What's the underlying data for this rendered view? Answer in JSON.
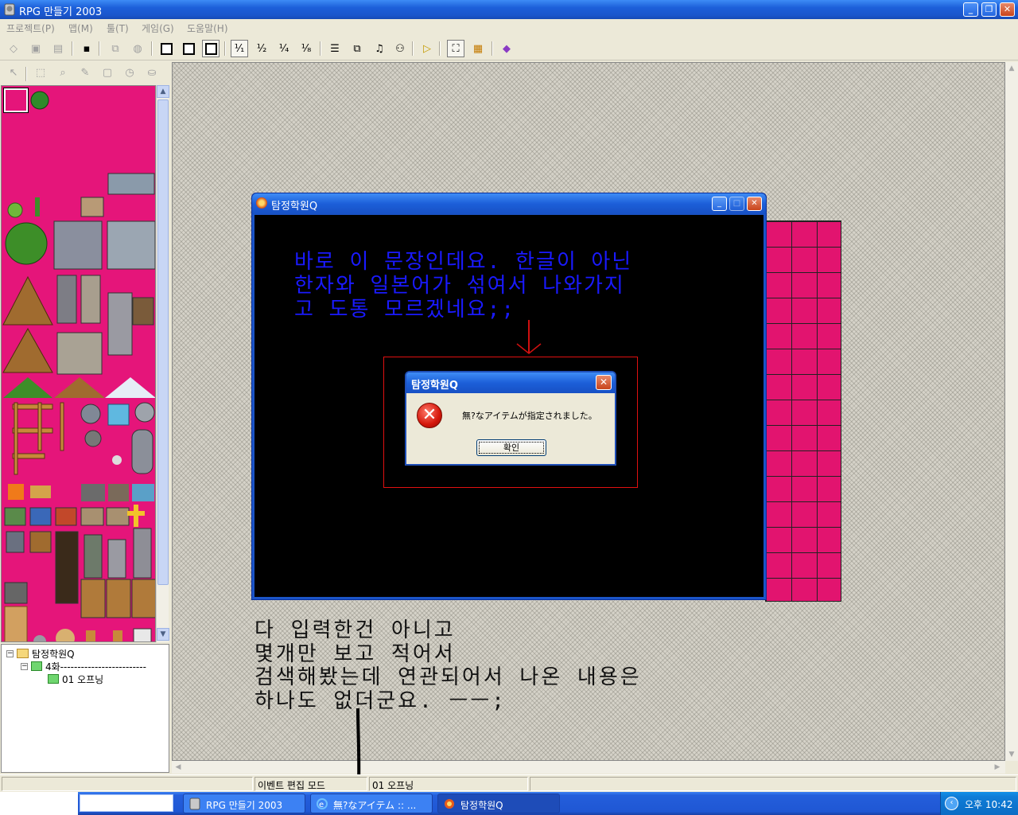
{
  "window": {
    "title": "RPG 만들기 2003"
  },
  "menu": [
    "프로젝트(P)",
    "맵(M)",
    "툴(T)",
    "게임(G)",
    "도움말(H)"
  ],
  "maptree": {
    "root": "탐정학원Q",
    "child": "4화-------------------------",
    "grandchild": "01 오프닝"
  },
  "game_window": {
    "title": "탐정학원Q",
    "text": "바로 이 문장인데요. 한글이 아닌\n한자와 일본어가 섞여서 나와가지\n고 도통 모르겠네요;;"
  },
  "error_dialog": {
    "title": "탐정학원Q",
    "message": "無?なアイテムが指定されました。",
    "ok_label": "확인"
  },
  "note_text": "다 입력한건 아니고\n몇개만 보고 적어서\n검색해봤는데 연관되어서 나온 내용은\n하나도 없더군요. ㅡㅡ;",
  "statusbar": {
    "mode": "이벤트 편집 모드",
    "map": "01 오프닝"
  },
  "taskbar": {
    "tasks": [
      {
        "label": "RPG 만들기 2003"
      },
      {
        "label": "無?なアイテム :: ..."
      },
      {
        "label": "탐정학원Q"
      }
    ],
    "clock": "오후 10:42"
  },
  "colors": {
    "tile_pink": "#e5157a",
    "xp_blue": "#1c5fd9",
    "annotation_red": "#e01010",
    "game_text_blue": "#1a1aff"
  },
  "toolbar_icons": [
    "new-project-icon",
    "open-project-icon",
    "close-project-icon",
    "save-icon",
    "undo-icon",
    "redo-icon",
    "layer-lower-icon",
    "layer-upper-icon",
    "event-layer-icon",
    "zoom-1-icon",
    "zoom-2-icon",
    "zoom-4-icon",
    "zoom-8-icon",
    "database-icon",
    "material-manager-icon",
    "music-icon",
    "search-icon",
    "play-test-icon",
    "fullscreen-icon",
    "title-screen-icon",
    "help-icon"
  ]
}
